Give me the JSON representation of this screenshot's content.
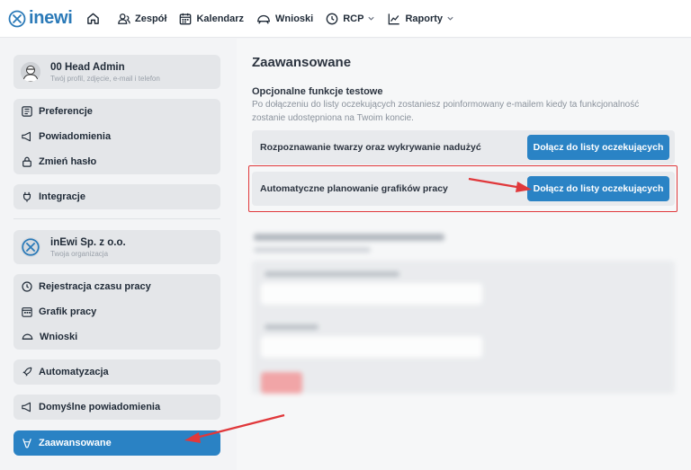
{
  "app": {
    "logo_text": "inewi"
  },
  "nav": {
    "items": [
      {
        "label": "Zespół"
      },
      {
        "label": "Kalendarz"
      },
      {
        "label": "Wnioski"
      },
      {
        "label": "RCP"
      },
      {
        "label": "Raporty"
      }
    ]
  },
  "sidebar": {
    "profile": {
      "name": "00 Head Admin",
      "subtitle": "Twój profil, zdjęcie, e-mail i telefon"
    },
    "personal_items": [
      {
        "label": "Preferencje"
      },
      {
        "label": "Powiadomienia"
      },
      {
        "label": "Zmień hasło"
      }
    ],
    "integrations": {
      "label": "Integracje"
    },
    "organization": {
      "name": "inEwi Sp. z o.o.",
      "subtitle": "Twoja organizacja"
    },
    "org_items": [
      {
        "label": "Rejestracja czasu pracy"
      },
      {
        "label": "Grafik pracy"
      },
      {
        "label": "Wnioski"
      }
    ],
    "automation": {
      "label": "Automatyzacja"
    },
    "default_notifications": {
      "label": "Domyślne powiadomienia"
    },
    "advanced": {
      "label": "Zaawansowane"
    }
  },
  "main": {
    "title": "Zaawansowane",
    "section_title": "Opcjonalne funkcje testowe",
    "section_desc": "Po dołączeniu do listy oczekujących zostaniesz poinformowany e-mailem kiedy ta funkcjonalność zostanie udostępniona na Twoim koncie.",
    "features": [
      {
        "label": "Rozpoznawanie twarzy oraz wykrywanie nadużyć",
        "button": "Dołącz do listy oczekujących"
      },
      {
        "label": "Automatyczne planowanie grafików pracy",
        "button": "Dołącz do listy oczekujących"
      }
    ]
  },
  "colors": {
    "accent": "#2a83c5",
    "annotation": "#e0383b",
    "sidebar_active": "#2a82c4"
  }
}
